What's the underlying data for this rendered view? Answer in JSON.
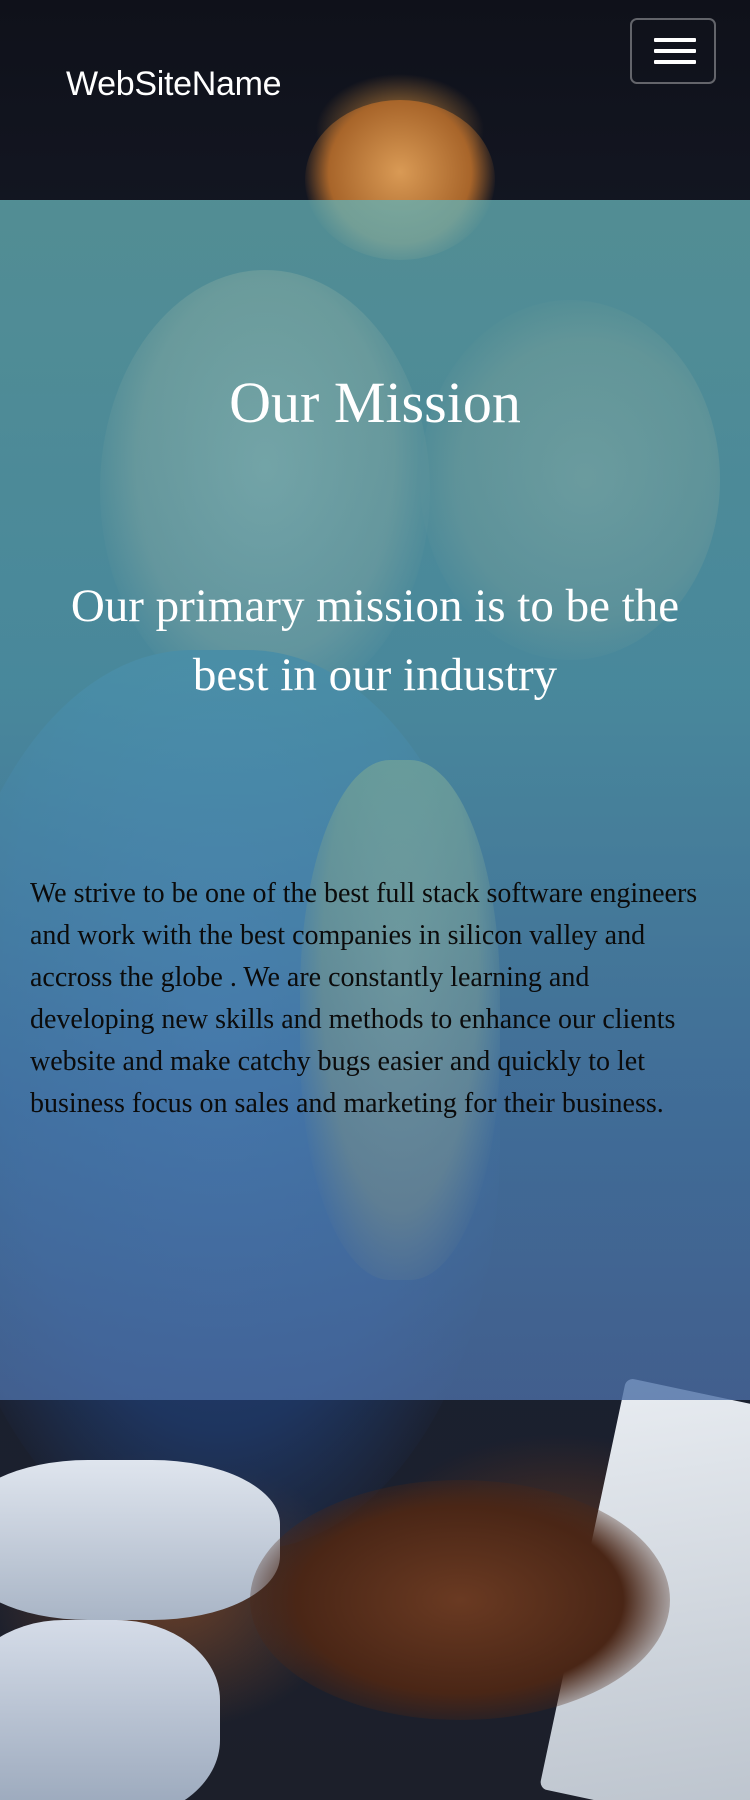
{
  "navbar": {
    "brand": "WebSiteName",
    "menu_icon": "hamburger-menu-icon"
  },
  "mission": {
    "title": "Our Mission",
    "subtitle": "Our primary mission is to be the best in our industry",
    "body": "We strive to be one of the best full stack software engineers and work with the best companies in silicon valley and accross the globe . We are constantly learning and developing new skills and methods to enhance our clients website and make catchy bugs easier and quickly to let business focus on sales and marketing for their business."
  },
  "colors": {
    "overlay": "#5aa8b8",
    "text_light": "#ffffff",
    "text_dark": "#0b0b0b"
  }
}
